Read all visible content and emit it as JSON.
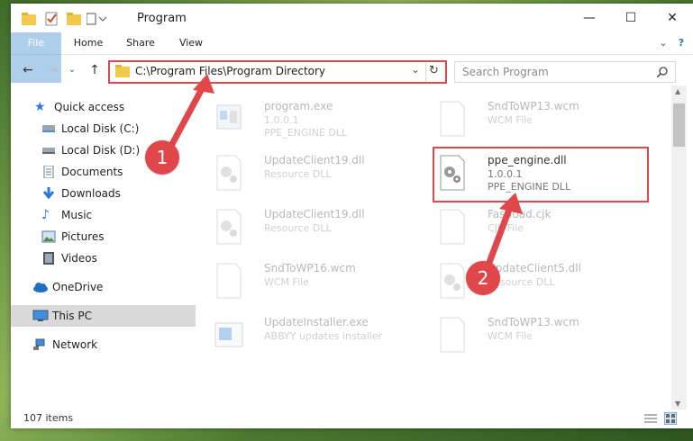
{
  "window": {
    "title": "Program"
  },
  "ribbon": {
    "tabs": [
      "File",
      "Home",
      "Share",
      "View"
    ]
  },
  "address": {
    "path": "C:\\Program Files\\Program Directory"
  },
  "search": {
    "placeholder": "Search Program"
  },
  "sidebar": {
    "items": [
      {
        "label": "Quick access",
        "icon": "star-icon",
        "pinned": false
      },
      {
        "label": "Local Disk (C:)",
        "icon": "drive-icon",
        "pinned": false
      },
      {
        "label": "Local Disk (D:)",
        "icon": "drive-icon",
        "pinned": true
      },
      {
        "label": "Documents",
        "icon": "documents-icon",
        "pinned": true
      },
      {
        "label": "Downloads",
        "icon": "download-icon",
        "pinned": true
      },
      {
        "label": "Music",
        "icon": "music-icon",
        "pinned": true
      },
      {
        "label": "Pictures",
        "icon": "pictures-icon",
        "pinned": true
      },
      {
        "label": "Videos",
        "icon": "videos-icon",
        "pinned": true
      },
      {
        "label": "OneDrive",
        "icon": "cloud-icon",
        "pinned": false
      },
      {
        "label": "This PC",
        "icon": "computer-icon",
        "pinned": false
      },
      {
        "label": "Network",
        "icon": "network-icon",
        "pinned": false
      }
    ]
  },
  "files": [
    {
      "name": "program.exe",
      "line1": "1.0.0.1",
      "line2": "PPE_ENGINE DLL"
    },
    {
      "name": "SndToWP13.wcm",
      "line1": "WCM File",
      "line2": ""
    },
    {
      "name": "UpdateClient19.dll",
      "line1": "Resource DLL",
      "line2": ""
    },
    {
      "name": "ppe_engine.dll",
      "line1": "1.0.0.1",
      "line2": "PPE_ENGINE DLL"
    },
    {
      "name": "UpdateClient19.dll",
      "line1": "Resource DLL",
      "line2": ""
    },
    {
      "name": "Fastload.cjk",
      "line1": "CJK File",
      "line2": ""
    },
    {
      "name": "SndToWP16.wcm",
      "line1": "WCM File",
      "line2": ""
    },
    {
      "name": "UpdateClient5.dll",
      "line1": "Resource DLL",
      "line2": ""
    },
    {
      "name": "UpdateInstaller.exe",
      "line1": "ABBYY updates installer",
      "line2": ""
    },
    {
      "name": "SndToWP13.wcm",
      "line1": "WCM File",
      "line2": ""
    }
  ],
  "status": {
    "count": "107 items"
  },
  "annotations": {
    "step1": "1",
    "step2": "2"
  }
}
